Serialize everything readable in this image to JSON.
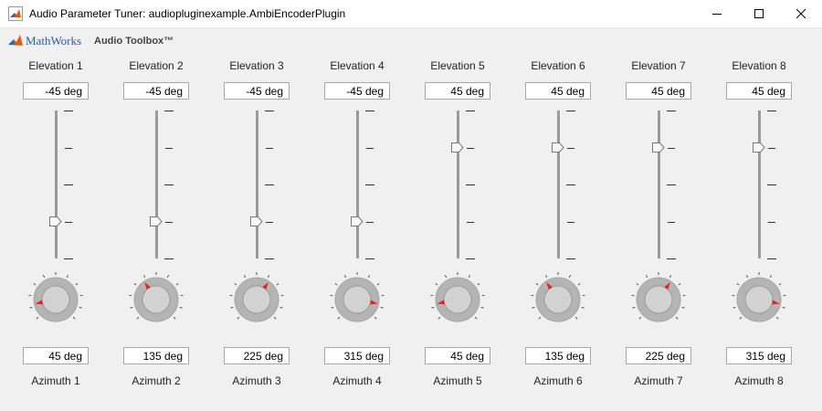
{
  "window": {
    "title": "Audio Parameter Tuner: audiopluginexample.AmbiEncoderPlugin",
    "buttons": [
      "minimize",
      "maximize",
      "close"
    ]
  },
  "brand": {
    "company": "MathWorks",
    "product": "Audio Toolbox™"
  },
  "colors": {
    "knob_pointer": "#e0251b",
    "track": "#9a9a9a",
    "knob_body": "#c8c8c8"
  },
  "channels": [
    {
      "elevation_label": "Elevation 1",
      "elevation_value": "-45 deg",
      "elevation": -45,
      "azimuth_label": "Azimuth 1",
      "azimuth_value": "45 deg",
      "azimuth": 45
    },
    {
      "elevation_label": "Elevation 2",
      "elevation_value": "-45 deg",
      "elevation": -45,
      "azimuth_label": "Azimuth 2",
      "azimuth_value": "135 deg",
      "azimuth": 135
    },
    {
      "elevation_label": "Elevation 3",
      "elevation_value": "-45 deg",
      "elevation": -45,
      "azimuth_label": "Azimuth 3",
      "azimuth_value": "225 deg",
      "azimuth": 225
    },
    {
      "elevation_label": "Elevation 4",
      "elevation_value": "-45 deg",
      "elevation": -45,
      "azimuth_label": "Azimuth 4",
      "azimuth_value": "315 deg",
      "azimuth": 315
    },
    {
      "elevation_label": "Elevation 5",
      "elevation_value": "45 deg",
      "elevation": 45,
      "azimuth_label": "Azimuth 5",
      "azimuth_value": "45 deg",
      "azimuth": 45
    },
    {
      "elevation_label": "Elevation 6",
      "elevation_value": "45 deg",
      "elevation": 45,
      "azimuth_label": "Azimuth 6",
      "azimuth_value": "135 deg",
      "azimuth": 135
    },
    {
      "elevation_label": "Elevation 7",
      "elevation_value": "45 deg",
      "elevation": 45,
      "azimuth_label": "Azimuth 7",
      "azimuth_value": "225 deg",
      "azimuth": 225
    },
    {
      "elevation_label": "Elevation 8",
      "elevation_value": "45 deg",
      "elevation": 45,
      "azimuth_label": "Azimuth 8",
      "azimuth_value": "315 deg",
      "azimuth": 315
    }
  ]
}
